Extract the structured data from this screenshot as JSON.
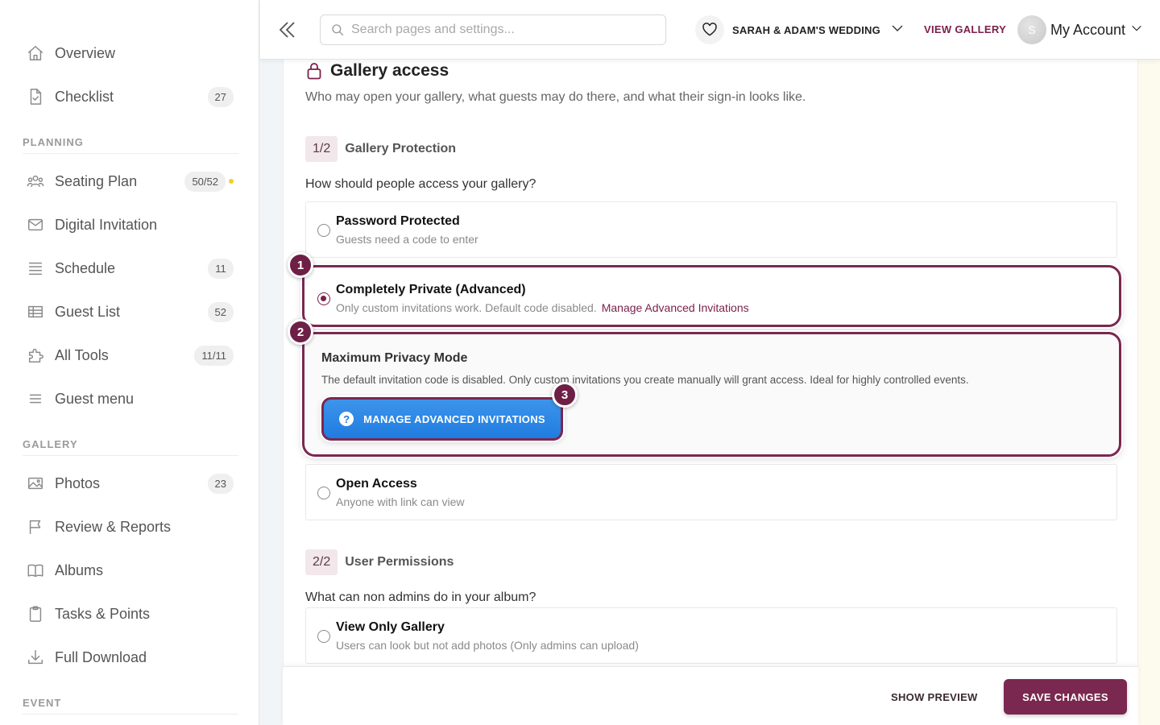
{
  "sidebar": {
    "items": [
      {
        "label": "Overview",
        "badge": null
      },
      {
        "label": "Checklist",
        "badge": "27"
      },
      {
        "label": "Seating Plan",
        "badge": "50/52"
      },
      {
        "label": "Digital Invitation",
        "badge": null
      },
      {
        "label": "Schedule",
        "badge": "11"
      },
      {
        "label": "Guest List",
        "badge": "52"
      },
      {
        "label": "All Tools",
        "badge": "11/11"
      },
      {
        "label": "Guest menu",
        "badge": null
      },
      {
        "label": "Photos",
        "badge": "23"
      },
      {
        "label": "Review & Reports",
        "badge": null
      },
      {
        "label": "Albums",
        "badge": null
      },
      {
        "label": "Tasks & Points",
        "badge": null
      },
      {
        "label": "Full Download",
        "badge": null
      }
    ],
    "sections": {
      "planning": "PLANNING",
      "gallery": "GALLERY",
      "event": "EVENT"
    }
  },
  "header": {
    "search_placeholder": "Search pages and settings...",
    "event_name": "SARAH & ADAM'S WEDDING",
    "view_gallery": "VIEW GALLERY",
    "avatar_initial": "S",
    "account_label": "My Account"
  },
  "main": {
    "title": "Gallery access",
    "subtitle": "Who may open your gallery, what guests may do there, and what their sign-in looks like.",
    "step1": {
      "badge": "1/2",
      "title": "Gallery Protection"
    },
    "question1": "How should people access your gallery?",
    "options": {
      "password": {
        "title": "Password Protected",
        "sub": "Guests need a code to enter"
      },
      "private": {
        "title": "Completely Private (Advanced)",
        "sub": "Only custom invitations work. Default code disabled.",
        "link": "Manage Advanced Invitations"
      },
      "open": {
        "title": "Open Access",
        "sub": "Anyone with link can view"
      },
      "view_only": {
        "title": "View Only Gallery",
        "sub": "Users can look but not add photos (Only admins can upload)"
      }
    },
    "privacy": {
      "title": "Maximum Privacy Mode",
      "text": "The default invitation code is disabled. Only custom invitations you create manually will grant access. Ideal for highly controlled events.",
      "button": "MANAGE ADVANCED INVITATIONS",
      "button_icon": "?"
    },
    "step2": {
      "badge": "2/2",
      "title": "User Permissions"
    },
    "question2": "What can non admins do in your album?",
    "selected_option": "private"
  },
  "markers": [
    "1",
    "2",
    "3"
  ],
  "footer": {
    "show_preview": "SHOW PREVIEW",
    "save": "SAVE CHANGES"
  },
  "colors": {
    "brand": "#7a2850",
    "accent_blue": "#1f7ce0",
    "seating_dot": "#f2cf2a"
  }
}
